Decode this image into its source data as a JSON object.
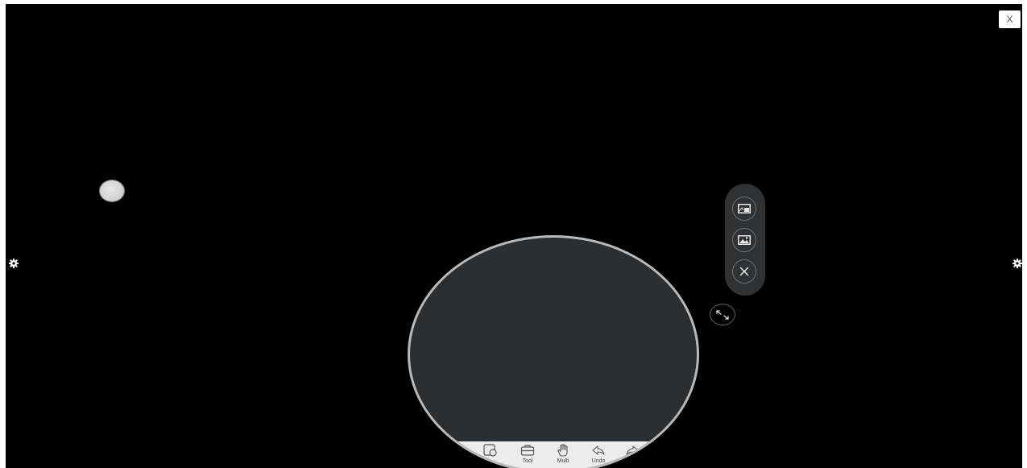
{
  "window": {
    "close_label": "X"
  },
  "icons": {
    "left_gear": "gear-icon",
    "right_gear": "gear-icon",
    "floating_ball": "floating-ball-icon",
    "panel_buttons": [
      "picture-in-picture-icon",
      "image-icon",
      "close-icon"
    ],
    "resize": "resize-arrows-icon"
  },
  "toolbar": {
    "items": [
      {
        "icon": "shape-icon",
        "label": ""
      },
      {
        "icon": "toolbox-icon",
        "label": "Tool"
      },
      {
        "icon": "hand-icon",
        "label": "Multi"
      },
      {
        "icon": "undo-icon",
        "label": "Undo"
      },
      {
        "icon": "redo-icon",
        "label": ""
      }
    ]
  },
  "colors": {
    "canvas": "#000000",
    "lens_fill": "#2b2f31",
    "lens_border": "#b9b9b9",
    "panel": "#2f3133",
    "toolbar": "#ececec"
  }
}
